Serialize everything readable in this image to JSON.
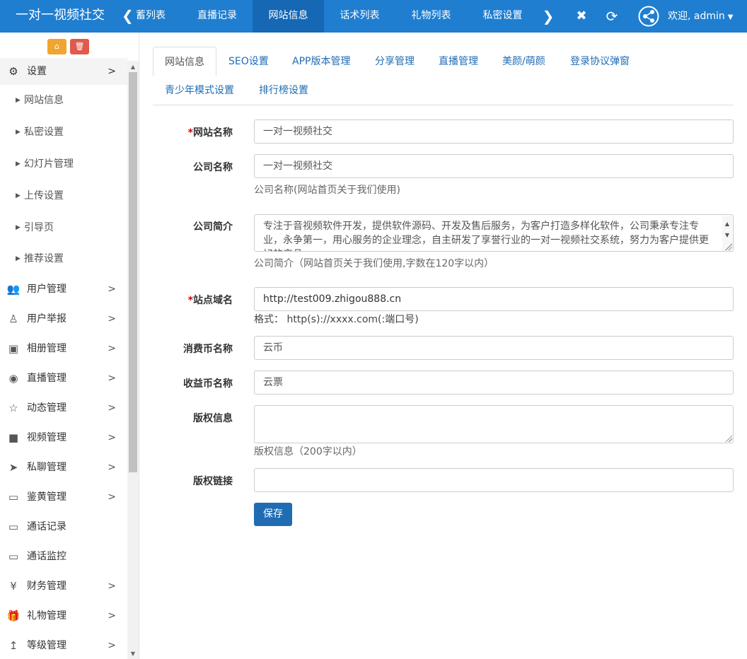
{
  "header": {
    "brand": "一对一视频社交",
    "tabs": [
      "蓄列表",
      "直播记录",
      "网站信息",
      "话术列表",
      "礼物列表",
      "私密设置"
    ],
    "active_tab": "网站信息",
    "welcome": "欢迎, admin",
    "icons": [
      "chevron-left-icon",
      "chevron-right-icon",
      "close-icon",
      "refresh-icon",
      "share-icon",
      "caret-down-icon"
    ]
  },
  "sidebar": {
    "top_buttons": [
      "home-icon",
      "trash-icon"
    ],
    "settings": {
      "label": "设置",
      "icon": "gears-icon"
    },
    "sub_items": [
      "网站信息",
      "私密设置",
      "幻灯片管理",
      "上传设置",
      "引导页",
      "推荐设置"
    ],
    "items": [
      {
        "label": "用户管理",
        "icon": "users-icon",
        "has_children": true
      },
      {
        "label": "用户举报",
        "icon": "user-report-icon",
        "has_children": true
      },
      {
        "label": "相册管理",
        "icon": "image-icon",
        "has_children": true
      },
      {
        "label": "直播管理",
        "icon": "eye-icon",
        "has_children": true
      },
      {
        "label": "动态管理",
        "icon": "star-icon",
        "has_children": true
      },
      {
        "label": "视频管理",
        "icon": "video-camera-icon",
        "has_children": true
      },
      {
        "label": "私聊管理",
        "icon": "telegram-icon",
        "has_children": true
      },
      {
        "label": "鉴黄管理",
        "icon": "desktop-icon",
        "has_children": true
      },
      {
        "label": "通话记录",
        "icon": "desktop-icon",
        "has_children": false
      },
      {
        "label": "通话监控",
        "icon": "desktop-icon",
        "has_children": false
      },
      {
        "label": "财务管理",
        "icon": "yen-icon",
        "has_children": true
      },
      {
        "label": "礼物管理",
        "icon": "gift-icon",
        "has_children": true
      },
      {
        "label": "等级管理",
        "icon": "level-up-icon",
        "has_children": true
      }
    ]
  },
  "content_tabs": [
    "网站信息",
    "SEO设置",
    "APP版本管理",
    "分享管理",
    "直播管理",
    "美颜/萌颜",
    "登录协议弹窗",
    "青少年模式设置",
    "排行榜设置"
  ],
  "form": {
    "site_name": {
      "label": "网站名称",
      "required_mark": "*",
      "value": "一对一视频社交"
    },
    "company_name": {
      "label": "公司名称",
      "value": "一对一视频社交",
      "help": "公司名称(网站首页关于我们使用)"
    },
    "company_intro": {
      "label": "公司简介",
      "value": "专注于音视频软件开发，提供软件源码、开发及售后服务，为客户打造多样化软件，公司秉承专注专业，永争第一，用心服务的企业理念，自主研发了享誉行业的一对一视频社交系统，努力为客户提供更好的产品",
      "help": "公司简介（网站首页关于我们使用,字数在120字以内）"
    },
    "domain": {
      "label": "站点域名",
      "required_mark": "*",
      "value": "http://test009.zhigou888.cn",
      "help": "格式： http(s)://xxxx.com(:端口号)"
    },
    "coin_name": {
      "label": "消费币名称",
      "value": "云币"
    },
    "vote_name": {
      "label": "收益币名称",
      "value": "云票"
    },
    "copyright": {
      "label": "版权信息",
      "value": "",
      "help": "版权信息（200字以内）"
    },
    "copyright_link": {
      "label": "版权链接",
      "value": ""
    },
    "save_label": "保存"
  }
}
